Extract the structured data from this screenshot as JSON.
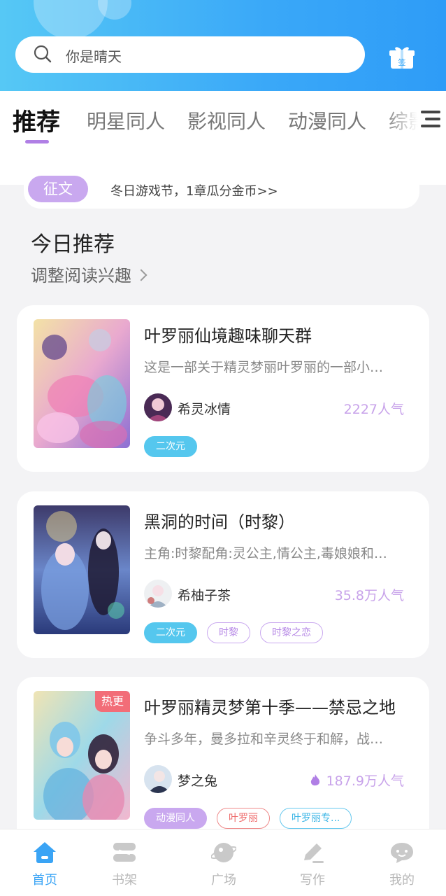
{
  "header": {
    "search_placeholder": "你是晴天",
    "checkin_label": "签"
  },
  "tabs": [
    "推荐",
    "明星同人",
    "影视同人",
    "动漫同人",
    "综影"
  ],
  "notice": {
    "badge": "征文",
    "text": "冬日游戏节，1章瓜分金币>>"
  },
  "section": {
    "title": "今日推荐",
    "subtitle": "调整阅读兴趣"
  },
  "cards": [
    {
      "title": "叶罗丽仙境趣味聊天群",
      "desc": "这是一部关于精灵梦丽叶罗丽的一部小…",
      "author": "希灵冰情",
      "popularity": "2227人气",
      "hot": false,
      "tags": [
        "二次元"
      ]
    },
    {
      "title": "黑洞的时间（时黎）",
      "desc": "主角:时黎配角:灵公主,情公主,毒娘娘和…",
      "author": "希柚子茶",
      "popularity": "35.8万人气",
      "hot": false,
      "tags": [
        "二次元",
        "时黎",
        "时黎之恋"
      ]
    },
    {
      "title": "叶罗丽精灵梦第十季——禁忌之地",
      "desc": "争斗多年，曼多拉和辛灵终于和解，战…",
      "author": "梦之兔",
      "popularity": "187.9万人气",
      "hot": true,
      "hot_label": "热更",
      "tags": [
        "动漫同人",
        "叶罗丽",
        "叶罗丽专..."
      ]
    }
  ],
  "bottom_nav": [
    {
      "label": "首页",
      "icon": "home-icon",
      "active": true
    },
    {
      "label": "书架",
      "icon": "bookshelf-icon",
      "active": false
    },
    {
      "label": "广场",
      "icon": "plaza-icon",
      "active": false
    },
    {
      "label": "写作",
      "icon": "pen-icon",
      "active": false
    },
    {
      "label": "我的",
      "icon": "profile-icon",
      "active": false
    }
  ],
  "colors": {
    "header_start": "#56c8f5",
    "header_end": "#2e9cf7",
    "accent_purple": "#b07fe5",
    "tag_blue": "#55c7ee",
    "popularity_purple": "#c8a3ea",
    "hot_red": "#f26d78",
    "nav_active": "#3aa4f5"
  }
}
